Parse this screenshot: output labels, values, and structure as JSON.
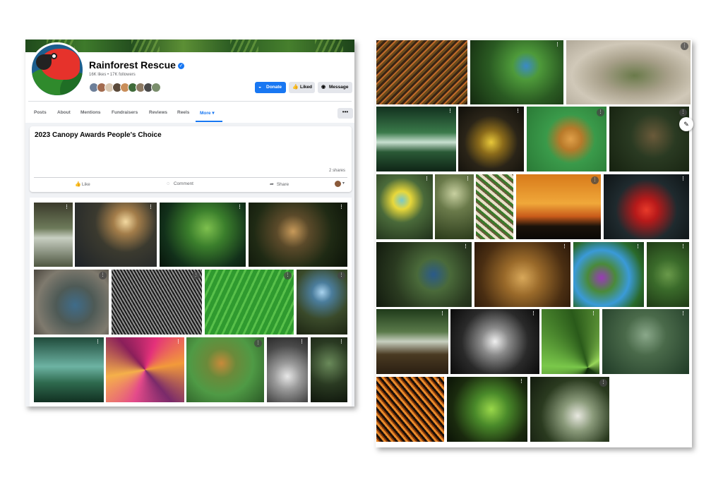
{
  "page": {
    "name": "Rainforest Rescue",
    "stats": "16K likes • 17K followers",
    "verified_mark": "✓"
  },
  "buttons": {
    "donate": "Donate",
    "liked": "Liked",
    "message": "Message",
    "more_options": "•••"
  },
  "tabs": [
    {
      "label": "Posts"
    },
    {
      "label": "About"
    },
    {
      "label": "Mentions"
    },
    {
      "label": "Fundraisers"
    },
    {
      "label": "Reviews"
    },
    {
      "label": "Reels"
    },
    {
      "label": "More ▾"
    }
  ],
  "post": {
    "title": "2023 Canopy Awards People's Choice",
    "shares": "2 shares",
    "actions": {
      "like": "Like",
      "comment": "Comment",
      "share": "Share"
    }
  },
  "photo_menu_glyph": "⋮",
  "icons": {
    "donate": "donate-icon",
    "liked": "thumbs-up-icon",
    "message": "messenger-icon",
    "like": "like-icon",
    "comment": "comment-icon",
    "share": "share-icon",
    "edit": "edit-icon",
    "verified": "verified-badge-icon"
  },
  "colors": {
    "accent": "#1877f2",
    "button_gray": "#e4e6eb",
    "feed_bg": "#f0f2f5",
    "text_secondary": "#65676b"
  }
}
